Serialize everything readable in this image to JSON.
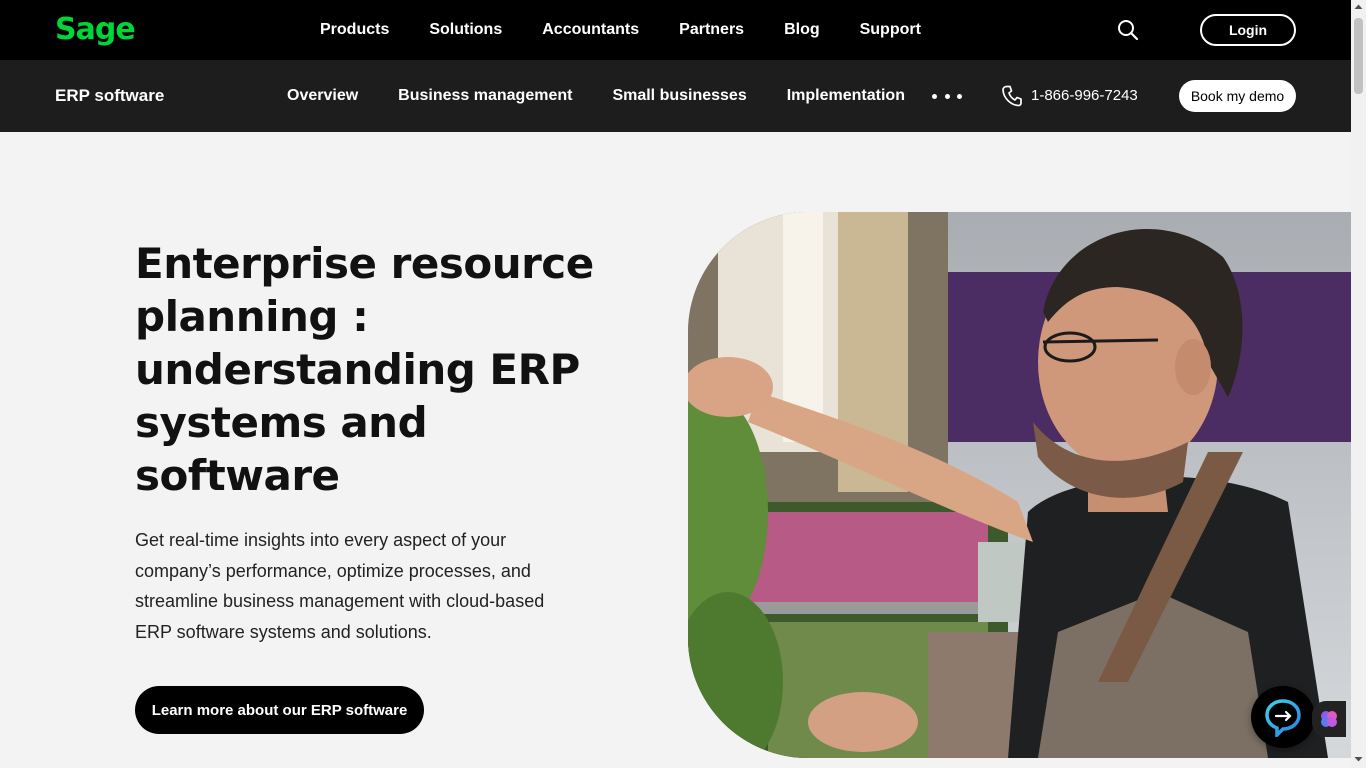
{
  "header": {
    "logo_text": "Sage",
    "nav": [
      "Products",
      "Solutions",
      "Accountants",
      "Partners",
      "Blog",
      "Support"
    ],
    "login_label": "Login"
  },
  "subheader": {
    "title": "ERP software",
    "nav": [
      "Overview",
      "Business management",
      "Small businesses",
      "Implementation"
    ],
    "phone": "1-866-996-7243",
    "demo_label": "Book my demo"
  },
  "hero": {
    "title": "Enterprise resource planning : understanding ERP systems and software",
    "description": "Get real-time insights into every aspect of your company’s performance, optimize processes, and streamline business management with cloud-based ERP software systems and solutions.",
    "cta_label": "Learn more about our ERP software"
  },
  "colors": {
    "brand_green": "#00d639",
    "topbar_bg": "#000000",
    "subbar_bg": "#1d1d1d",
    "page_bg": "#f3f3f3"
  }
}
